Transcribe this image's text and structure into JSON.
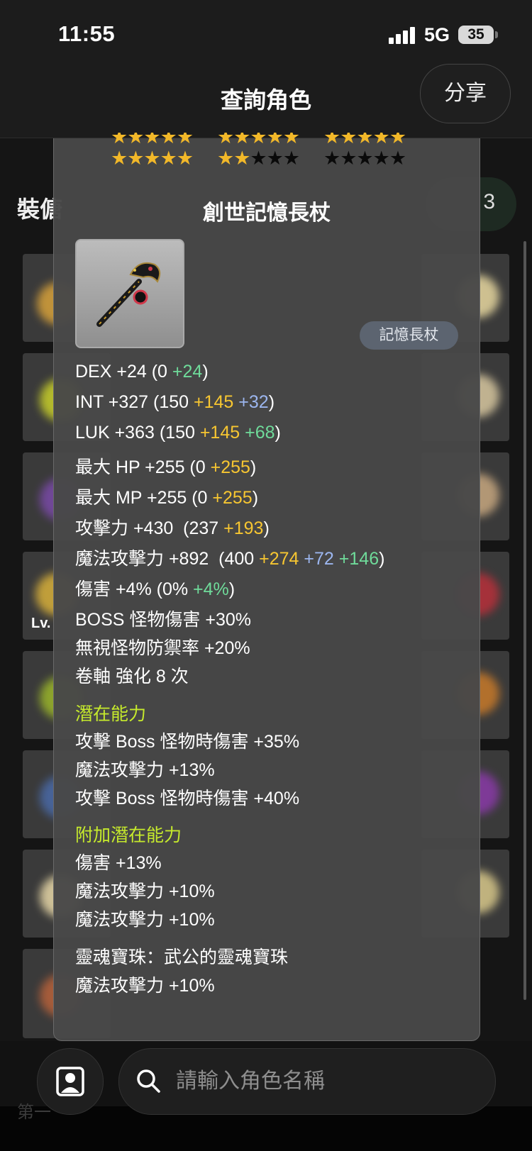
{
  "status_bar": {
    "time": "11:55",
    "network": "5G",
    "battery": "35"
  },
  "header": {
    "title": "查詢角色",
    "share_label": "分享"
  },
  "background": {
    "section_title": "裝備",
    "section_title_visible": "裝傏",
    "count": "3",
    "level_tag": "Lv.",
    "footer_text": "第一"
  },
  "popup": {
    "stars": {
      "total_rows": 2,
      "row1_filled": 15,
      "row2_filled": 7,
      "per_row": 15
    },
    "item_name": "創世記憶長杖",
    "item_type": "記憶長杖",
    "stats": [
      {
        "base": "DEX +24 (0 ",
        "parts": [
          {
            "text": "+24",
            "color": "green"
          }
        ],
        "tail": ")"
      },
      {
        "base": "INT +327 (150 ",
        "parts": [
          {
            "text": "+145",
            "color": "yellow"
          },
          {
            "text": "+32",
            "color": "blue"
          }
        ],
        "tail": ")"
      },
      {
        "base": "LUK +363 (150 ",
        "parts": [
          {
            "text": "+145",
            "color": "yellow"
          },
          {
            "text": "+68",
            "color": "green"
          }
        ],
        "tail": ")"
      },
      {
        "base": "最大 HP +255 (0 ",
        "parts": [
          {
            "text": "+255",
            "color": "yellow"
          }
        ],
        "tail": ")"
      },
      {
        "base": "最大 MP +255 (0 ",
        "parts": [
          {
            "text": "+255",
            "color": "yellow"
          }
        ],
        "tail": ")"
      },
      {
        "base": "攻擊力 +430  (237 ",
        "parts": [
          {
            "text": "+193",
            "color": "yellow"
          }
        ],
        "tail": ")"
      },
      {
        "base": "魔法攻擊力 +892  (400 ",
        "parts": [
          {
            "text": "+274",
            "color": "yellow"
          },
          {
            "text": "+72",
            "color": "blue"
          },
          {
            "text": "+146",
            "color": "green"
          }
        ],
        "tail": ")"
      },
      {
        "base": "傷害 +4% (0% ",
        "parts": [
          {
            "text": "+4%",
            "color": "green"
          }
        ],
        "tail": ")"
      }
    ],
    "extra_stats": [
      "BOSS 怪物傷害 +30%",
      "無視怪物防禦率 +20%",
      "卷軸 強化 8 次"
    ],
    "potential": {
      "title": "潛在能力",
      "lines": [
        "攻擊 Boss 怪物時傷害 +35%",
        "魔法攻擊力 +13%",
        "攻擊 Boss 怪物時傷害 +40%"
      ]
    },
    "additional_potential": {
      "title": "附加潛在能力",
      "lines": [
        "傷害 +13%",
        "魔法攻擊力 +10%",
        "魔法攻擊力 +10%"
      ]
    },
    "soul": {
      "name": "靈魂寶珠：武公的靈魂寶珠",
      "effect": "魔法攻擊力 +10%"
    }
  },
  "search": {
    "placeholder": "請輸入角色名稱"
  },
  "colors": {
    "yellow": "#f7c631",
    "blue": "#9cb6ef",
    "green": "#6fdb9a",
    "section": "#c6ea2c",
    "star": "#f2b829"
  }
}
